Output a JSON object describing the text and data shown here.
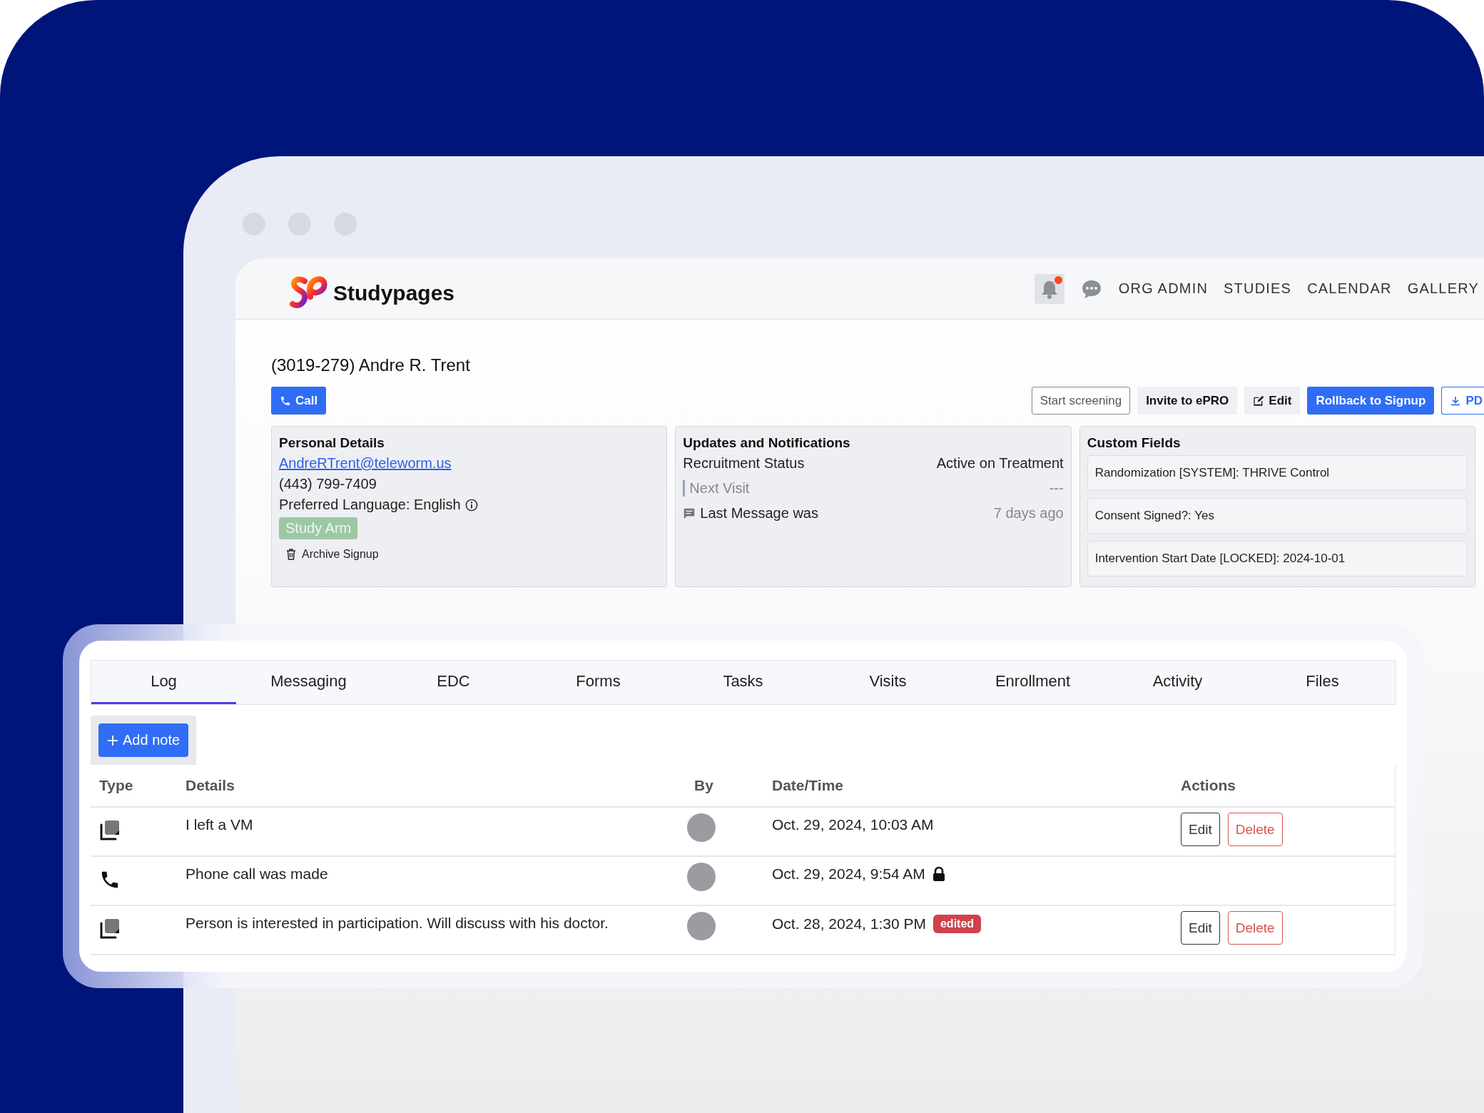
{
  "header": {
    "brand": "Studypages",
    "notifications": {
      "unread": true
    },
    "nav": [
      {
        "label": "ORG ADMIN"
      },
      {
        "label": "STUDIES"
      },
      {
        "label": "CALENDAR"
      },
      {
        "label": "GALLERY"
      }
    ]
  },
  "participant": {
    "title": "(3019-279) Andre R. Trent",
    "call_button": "Call",
    "actions": [
      {
        "label": "Start screening",
        "kind": "outline"
      },
      {
        "label": "Invite to ePRO",
        "kind": "light"
      },
      {
        "label": "Edit",
        "kind": "edit"
      },
      {
        "label": "Rollback to Signup",
        "kind": "primary"
      },
      {
        "label": "PD",
        "kind": "download"
      }
    ]
  },
  "personal_details": {
    "title": "Personal Details",
    "email": "AndreRTrent@teleworm.us",
    "phone": "(443) 799-7409",
    "language": "Preferred Language: English",
    "study_arm": "Study Arm",
    "archive": "Archive Signup"
  },
  "updates": {
    "title": "Updates and Notifications",
    "rows": [
      {
        "kind": "status",
        "label": "Recruitment Status",
        "value": "Active on Treatment"
      },
      {
        "kind": "visit",
        "label": "Next Visit",
        "value": "---"
      },
      {
        "kind": "message",
        "label": "Last Message was",
        "value": "7 days ago"
      }
    ]
  },
  "custom_fields": {
    "title": "Custom Fields",
    "fields": [
      "Randomization [SYSTEM]: THRIVE Control",
      "Consent Signed?: Yes",
      "Intervention Start Date [LOCKED]: 2024-10-01"
    ]
  },
  "tabs": [
    {
      "label": "Log",
      "selected": true
    },
    {
      "label": "Messaging",
      "selected": false
    },
    {
      "label": "EDC",
      "selected": false
    },
    {
      "label": "Forms",
      "selected": false
    },
    {
      "label": "Tasks",
      "selected": false
    },
    {
      "label": "Visits",
      "selected": false
    },
    {
      "label": "Enrollment",
      "selected": false
    },
    {
      "label": "Activity",
      "selected": false
    },
    {
      "label": "Files",
      "selected": false
    }
  ],
  "add_note": "Add note",
  "log": {
    "columns": [
      "Type",
      "Details",
      "By",
      "Date/Time",
      "Actions"
    ],
    "rows": [
      {
        "kind": "note",
        "details": "I left a VM",
        "datetime": "Oct. 29, 2024, 10:03 AM",
        "locked": false,
        "actions": [
          "Edit",
          "Delete"
        ]
      },
      {
        "kind": "call",
        "details": "Phone call was made",
        "datetime": "Oct. 29, 2024, 9:54 AM",
        "locked": true
      },
      {
        "kind": "note",
        "details": "Person is interested in participation. Will discuss with his doctor.",
        "datetime": "Oct. 28, 2024, 1:30 PM",
        "locked": false,
        "badge": "edited",
        "actions": [
          "Edit",
          "Delete"
        ]
      }
    ]
  }
}
